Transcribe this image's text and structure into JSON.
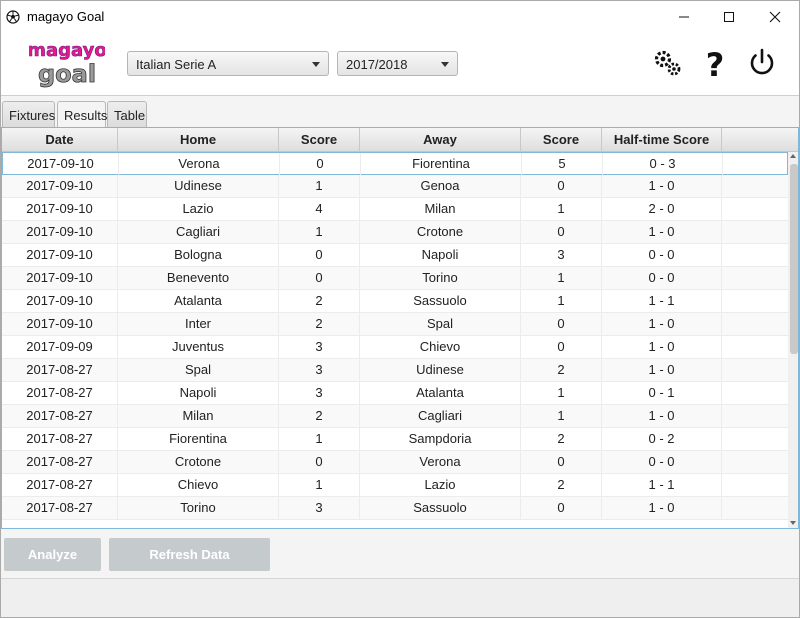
{
  "window": {
    "title": "magayo Goal"
  },
  "logo": {
    "line1": "magayo",
    "line2": "goal"
  },
  "header": {
    "league": "Italian Serie A",
    "season": "2017/2018"
  },
  "tabs": [
    {
      "label": "Fixtures"
    },
    {
      "label": "Results"
    },
    {
      "label": "Table"
    }
  ],
  "table": {
    "columns": [
      "Date",
      "Home",
      "Score",
      "Away",
      "Score",
      "Half-time Score"
    ],
    "rows": [
      [
        "2017-09-10",
        "Verona",
        "0",
        "Fiorentina",
        "5",
        "0 - 3"
      ],
      [
        "2017-09-10",
        "Udinese",
        "1",
        "Genoa",
        "0",
        "1 - 0"
      ],
      [
        "2017-09-10",
        "Lazio",
        "4",
        "Milan",
        "1",
        "2 - 0"
      ],
      [
        "2017-09-10",
        "Cagliari",
        "1",
        "Crotone",
        "0",
        "1 - 0"
      ],
      [
        "2017-09-10",
        "Bologna",
        "0",
        "Napoli",
        "3",
        "0 - 0"
      ],
      [
        "2017-09-10",
        "Benevento",
        "0",
        "Torino",
        "1",
        "0 - 0"
      ],
      [
        "2017-09-10",
        "Atalanta",
        "2",
        "Sassuolo",
        "1",
        "1 - 1"
      ],
      [
        "2017-09-10",
        "Inter",
        "2",
        "Spal",
        "0",
        "1 - 0"
      ],
      [
        "2017-09-09",
        "Juventus",
        "3",
        "Chievo",
        "0",
        "1 - 0"
      ],
      [
        "2017-08-27",
        "Spal",
        "3",
        "Udinese",
        "2",
        "1 - 0"
      ],
      [
        "2017-08-27",
        "Napoli",
        "3",
        "Atalanta",
        "1",
        "0 - 1"
      ],
      [
        "2017-08-27",
        "Milan",
        "2",
        "Cagliari",
        "1",
        "1 - 0"
      ],
      [
        "2017-08-27",
        "Fiorentina",
        "1",
        "Sampdoria",
        "2",
        "0 - 2"
      ],
      [
        "2017-08-27",
        "Crotone",
        "0",
        "Verona",
        "0",
        "0 - 0"
      ],
      [
        "2017-08-27",
        "Chievo",
        "1",
        "Lazio",
        "2",
        "1 - 1"
      ],
      [
        "2017-08-27",
        "Torino",
        "3",
        "Sassuolo",
        "0",
        "1 - 0"
      ]
    ]
  },
  "buttons": {
    "analyze": "Analyze",
    "refresh": "Refresh Data"
  }
}
